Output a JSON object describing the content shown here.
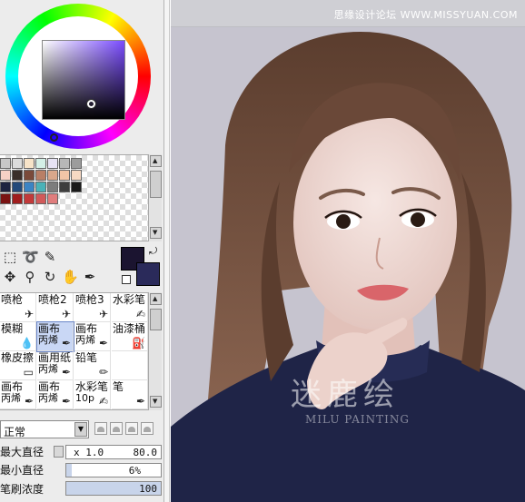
{
  "site_watermark": "思缘设计论坛 WWW.MISSYUAN.COM",
  "canvas_logo": {
    "title": "迷鹿绘",
    "subtitle": "MILU PAINTING"
  },
  "colors": {
    "foreground": "#1b1430",
    "background": "#2a2a5a",
    "hue": "#7a4cff",
    "swatch_rows": [
      [
        "#c8c8c8",
        "#dcdcdc",
        "#f7e3c8",
        "#d4efe6",
        "#e7e3f4",
        "#b7b7b7",
        "#9c9c9c"
      ],
      [
        "#f5d1c5",
        "#3a2e2a",
        "#7a4a3a",
        "#b97f66",
        "#d9a78b",
        "#f1c4a6",
        "#f7d9c3"
      ],
      [
        "#1c2340",
        "#234a7a",
        "#3b84c4",
        "#4ab2b8",
        "#7d7d7d",
        "#3e3e3e",
        "#1a1a1a"
      ],
      [
        "#7a1313",
        "#a01e1e",
        "#c23a3a",
        "#d15a5a",
        "#e07d7d"
      ]
    ]
  },
  "toolbox": {
    "icons": [
      "rect-select-icon",
      "lasso-icon",
      "magic-wand-icon",
      "move-icon",
      "zoom-icon",
      "rotate-icon",
      "hand-icon",
      "eyedropper-icon"
    ]
  },
  "brushes": [
    {
      "label": "喷枪",
      "sub": "",
      "icon": "airbrush-icon"
    },
    {
      "label": "喷枪2",
      "sub": "",
      "icon": "airbrush-icon"
    },
    {
      "label": "喷枪3",
      "sub": "",
      "icon": "airbrush-icon"
    },
    {
      "label": "水彩笔",
      "sub": "",
      "icon": "watercolor-icon"
    },
    {
      "label": "模糊",
      "sub": "",
      "icon": "blur-icon"
    },
    {
      "label": "画布",
      "sub": "丙烯",
      "icon": "pen-icon",
      "selected": true
    },
    {
      "label": "画布",
      "sub": "丙烯",
      "icon": "pen-icon"
    },
    {
      "label": "油漆桶",
      "sub": "",
      "icon": "bucket-icon"
    },
    {
      "label": "橡皮擦",
      "sub": "",
      "icon": "eraser-icon"
    },
    {
      "label": "画用纸",
      "sub": "丙烯",
      "icon": "pen-icon"
    },
    {
      "label": "铅笔",
      "sub": "",
      "icon": "pencil-icon"
    },
    {
      "label": "",
      "sub": "",
      "icon": ""
    },
    {
      "label": "画布",
      "sub": "丙烯",
      "icon": "pen-icon"
    },
    {
      "label": "画布",
      "sub": "丙烯",
      "icon": "pen-icon"
    },
    {
      "label": "水彩笔",
      "sub": "10p",
      "icon": "watercolor-icon"
    },
    {
      "label": "笔",
      "sub": "",
      "icon": "pen-icon"
    }
  ],
  "blend_mode": "正常",
  "settings": {
    "max_size_label": "最大直径",
    "max_size_mult": "x 1.0",
    "max_size_value": "80.0",
    "min_size_label": "最小直径",
    "min_size_value": "6%",
    "min_size_fraction": 0.06,
    "density_label": "笔刷浓度",
    "density_value": "100",
    "density_fraction": 1.0
  }
}
